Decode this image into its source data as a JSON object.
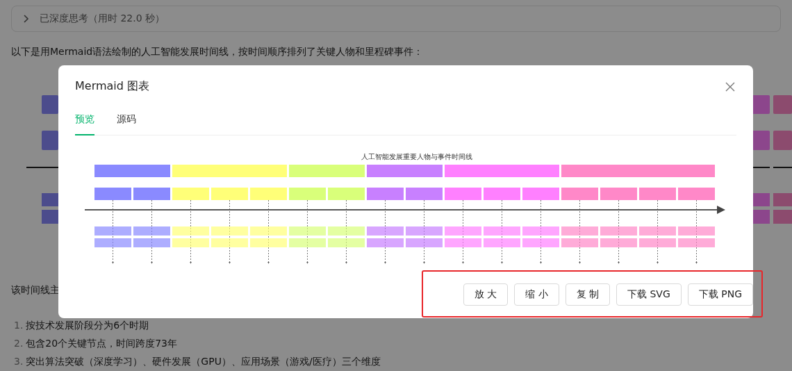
{
  "thinking": {
    "label": "已深度思考（用时 22.0 秒）",
    "expanded": false
  },
  "intro": "以下是用Mermaid语法绘制的人工智能发展时间线，按时间顺序排列了关键人物和里程碑事件：",
  "background_chart": {
    "left": [
      {
        "color": "#4c4c8c"
      }
    ],
    "right": [
      {
        "color": "#8c468c"
      },
      {
        "color": "#8c4b6e"
      }
    ]
  },
  "summary_fragment": "该时间线主",
  "summary_points": [
    {
      "marker": "1.",
      "text": "按技术发展阶段分为6个时期"
    },
    {
      "marker": "2.",
      "text": "包含20个关键节点，时间跨度73年"
    },
    {
      "marker": "3.",
      "text": "突出算法突破（深度学习）、硬件发展（GPU）、应用场景（游戏/医疗）三个维度"
    }
  ],
  "dialog": {
    "title": "Mermaid 图表",
    "tabs": [
      {
        "label": "预览",
        "selected": true
      },
      {
        "label": "源码",
        "selected": false
      }
    ],
    "diagram": {
      "title": "人工智能发展重要人物与事件时间线",
      "sections": [
        {
          "color": "#8a8aff"
        },
        {
          "color": "#ffff78"
        },
        {
          "color": "#d9ff7a"
        },
        {
          "color": "#c880ff"
        },
        {
          "color": "#ff80ff"
        },
        {
          "color": "#ff88c8"
        }
      ]
    },
    "buttons": [
      "放 大",
      "缩 小",
      "复 制",
      "下载 SVG",
      "下载 PNG"
    ],
    "highlighted_buttons": true
  }
}
